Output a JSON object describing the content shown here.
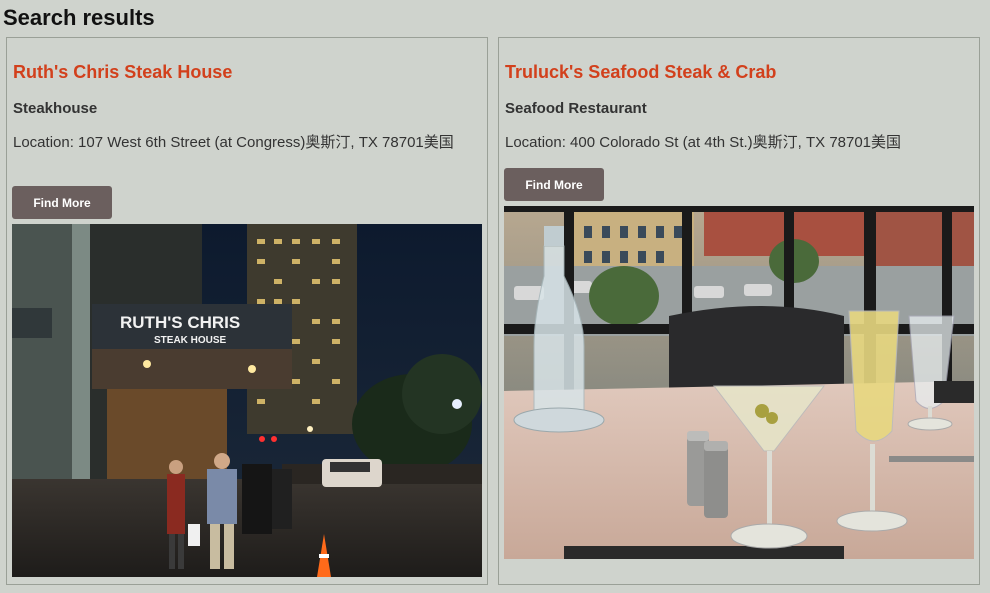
{
  "page": {
    "title": "Search results"
  },
  "results": [
    {
      "name": "Ruth's Chris Steak House",
      "category": "Steakhouse",
      "location": "Location: 107 West 6th Street (at Congress)奥斯汀, TX 78701美国",
      "button_label": "Find More",
      "sign_text": "RUTH'S CHRIS",
      "sign_subtext": "STEAK HOUSE"
    },
    {
      "name": "Truluck's Seafood Steak & Crab",
      "category": "Seafood Restaurant",
      "location": "Location: 400 Colorado St (at 4th St.)奥斯汀, TX 78701美国",
      "button_label": "Find More"
    }
  ],
  "colors": {
    "background": "#cfd3cd",
    "title_accent": "#d2401c",
    "button": "#6b5f5e"
  }
}
